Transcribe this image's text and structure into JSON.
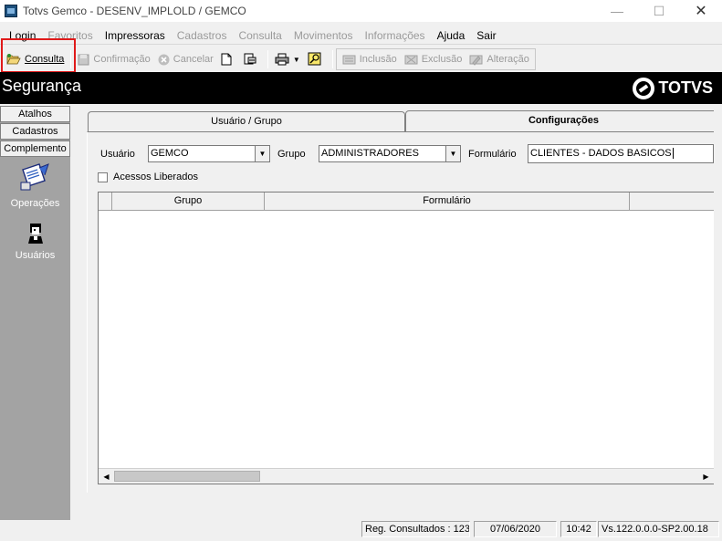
{
  "window": {
    "title": "Totvs Gemco - DESENV_IMPLOLD / GEMCO"
  },
  "menu": [
    {
      "label": "Login",
      "disabled": false
    },
    {
      "label": "Favoritos",
      "disabled": true
    },
    {
      "label": "Impressoras",
      "disabled": false
    },
    {
      "label": "Cadastros",
      "disabled": true
    },
    {
      "label": "Consulta",
      "disabled": true
    },
    {
      "label": "Movimentos",
      "disabled": true
    },
    {
      "label": "Informações",
      "disabled": true
    },
    {
      "label": "Ajuda",
      "disabled": false
    },
    {
      "label": "Sair",
      "disabled": false
    }
  ],
  "toolbar": {
    "consulta": "Consulta",
    "confirmacao": "Confirmação",
    "cancelar": "Cancelar",
    "inclusao": "Inclusão",
    "exclusao": "Exclusão",
    "alteracao": "Alteração"
  },
  "header": {
    "title": "Segurança",
    "logo": "TOTVS"
  },
  "sidebar": {
    "tabs": [
      "Atalhos",
      "Cadastros",
      "Complemento"
    ],
    "items": [
      {
        "label": "Operações",
        "icon": "operations-icon"
      },
      {
        "label": "Usuários",
        "icon": "users-icon"
      }
    ]
  },
  "tabs": {
    "usuario_grupo": "Usuário  / Grupo",
    "configuracoes": "Configurações"
  },
  "form": {
    "usuario_label": "Usuário",
    "usuario_value": "GEMCO",
    "grupo_label": "Grupo",
    "grupo_value": "ADMINISTRADORES",
    "formulario_label": "Formulário",
    "formulario_value": "CLIENTES - DADOS BASICOS",
    "acessos_label": "Acessos Liberados"
  },
  "grid": {
    "columns": [
      "",
      "Grupo",
      "Formulário",
      ""
    ]
  },
  "status": {
    "reg": "Reg. Consultados : 123",
    "date": "07/06/2020",
    "time": "10:42",
    "version": "Vs.122.0.0.0-SP2.00.18"
  },
  "colors": {
    "highlight": "#e01a1a",
    "header_band": "#000000",
    "sidebar": "#a3a3a3"
  }
}
